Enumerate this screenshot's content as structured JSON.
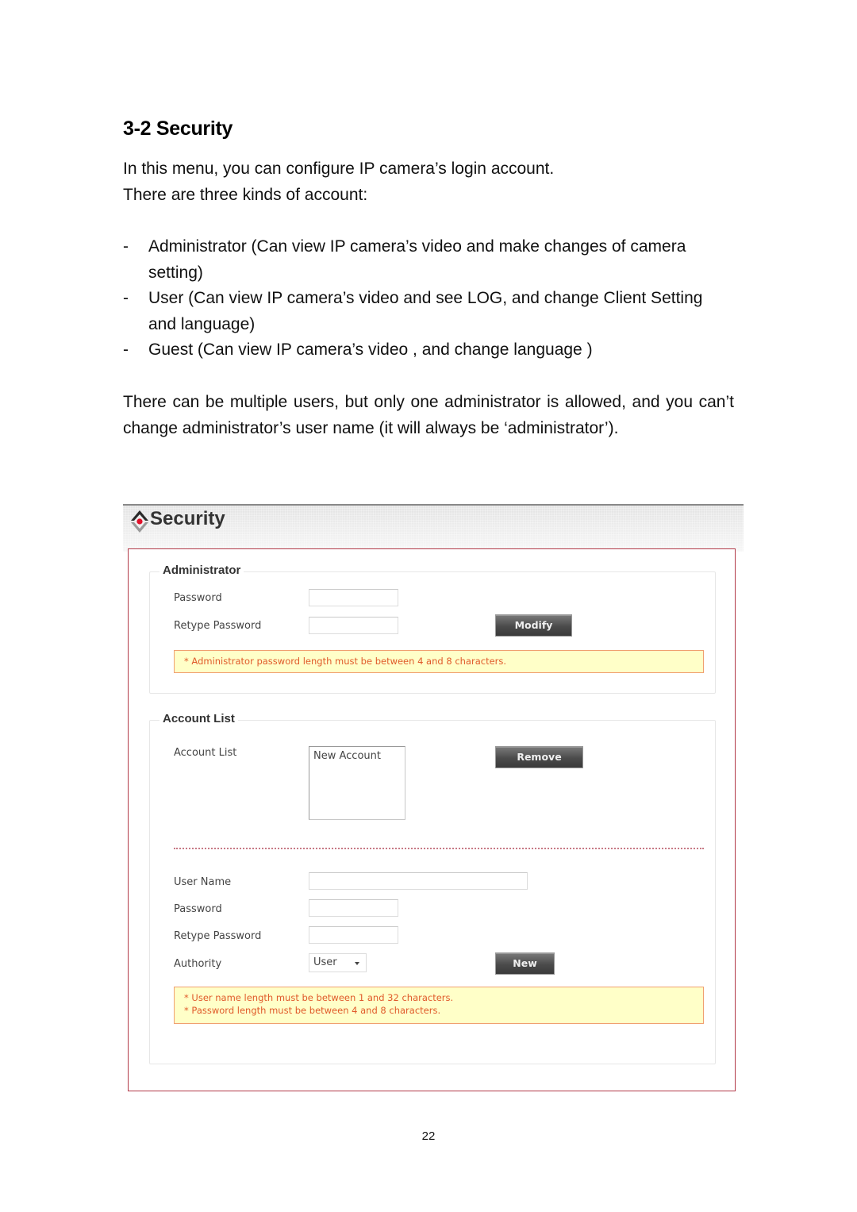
{
  "document": {
    "heading": "3-2 Security",
    "intro_lines": [
      "In this menu, you can configure IP camera’s login account.",
      "There are three kinds of account:"
    ],
    "bullet_marker": "-",
    "account_types": [
      "Administrator (Can view IP camera’s video and make changes of camera setting)",
      "User (Can view IP camera’s video and see LOG, and change Client Setting and language)",
      "Guest (Can view IP camera’s video , and change language )"
    ],
    "paragraph": "There can be multiple users, but only one administrator is allowed, and you can’t change administrator’s user name (it will always be ‘administrator’).",
    "page_number": "22"
  },
  "screenshot": {
    "logo_icon": "camera-logo-icon",
    "title": "Security",
    "colors": {
      "frame_border": "#b23a48",
      "note_background": "#ffffc8",
      "note_text": "#e05a2a",
      "button_dark": "#4b4b4b"
    },
    "administrator": {
      "legend": "Administrator",
      "password_label": "Password",
      "password_value": "",
      "retype_label": "Retype Password",
      "retype_value": "",
      "modify_button": "Modify",
      "note": "* Administrator password length must be between 4 and 8 characters."
    },
    "account_list": {
      "legend": "Account List",
      "list_label": "Account List",
      "items": [
        "New Account"
      ],
      "remove_button": "Remove",
      "user_name_label": "User Name",
      "user_name_value": "",
      "password_label": "Password",
      "password_value": "",
      "retype_label": "Retype Password",
      "retype_value": "",
      "authority_label": "Authority",
      "authority_selected": "User",
      "new_button": "New",
      "notes": [
        "* User name length must be between 1 and 32 characters.",
        "* Password length must be between 4 and 8 characters."
      ]
    }
  }
}
